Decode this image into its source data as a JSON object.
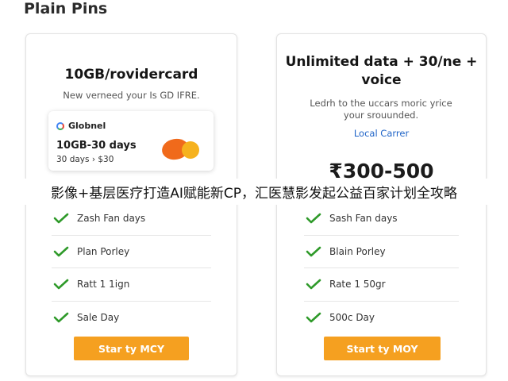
{
  "page": {
    "title": "Plain Pins",
    "overlay_caption": "影像+基层医疗打造AI赋能新CP，汇医慧影发起公益百家计划全攻略"
  },
  "colors": {
    "accent": "#f5a020",
    "check": "#2f9a2a",
    "link": "#1e63c7",
    "sim_orange": "#f06a1b",
    "sim_yellow": "#f6b21e"
  },
  "plans": [
    {
      "title": "10GB/rovidercard",
      "description": "New verneed your Is GD IFRE.",
      "card": {
        "brand": "Globnel",
        "brand_icon": "globe-logo-icon",
        "data": "10GB-30 days",
        "price": "30 days › $30"
      },
      "features": [
        "Zash Fan days",
        "Plan Porley",
        "Ratt 1 1ign",
        "Sale Day"
      ],
      "button": "Star ty MCY"
    },
    {
      "title": "Unlimited data + 30/ne + voice",
      "description": "Ledrh to the uccars moric yrice your srouunded.",
      "carrier": "Local Carrer",
      "price": "₹300-500",
      "features": [
        "Sash Fan days",
        "Blain Porley",
        "Rate 1 50gr",
        "500c Day"
      ],
      "button": "Start ty MOY"
    }
  ]
}
